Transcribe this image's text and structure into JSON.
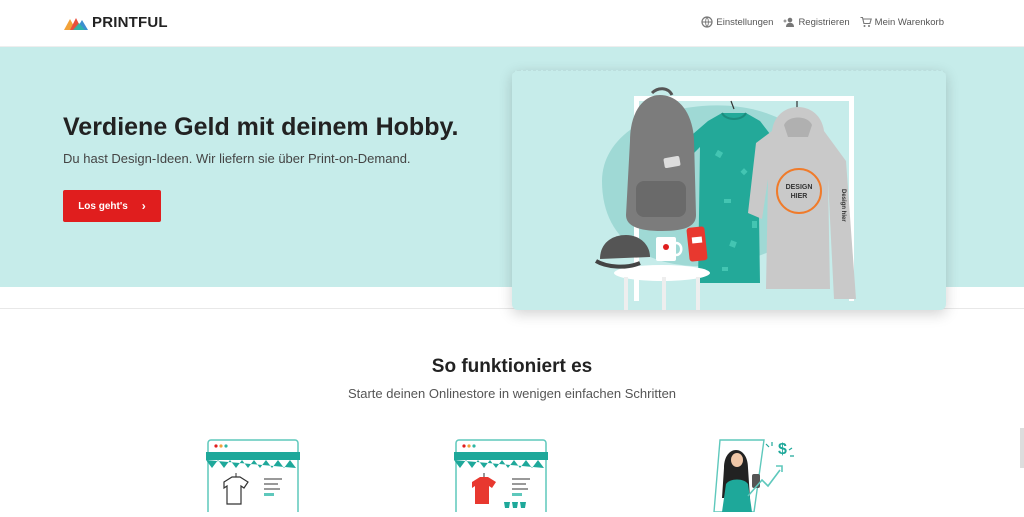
{
  "header": {
    "logo_text": "PRINTFUL",
    "nav": [
      {
        "label": "Einstellungen",
        "icon": "globe-icon"
      },
      {
        "label": "Registrieren",
        "icon": "add-user-icon"
      },
      {
        "label": "Mein Warenkorb",
        "icon": "cart-icon"
      }
    ]
  },
  "hero": {
    "title": "Verdiene Geld mit deinem Hobby.",
    "subtitle": "Du hast Design-Ideen. Wir liefern sie über Print-on-Demand.",
    "cta_label": "Los geht's",
    "image_text": {
      "hoodie_line1": "DESIGN",
      "hoodie_line2": "HIER",
      "sleeve": "Design hier"
    }
  },
  "how": {
    "title": "So funktioniert es",
    "subtitle": "Starte deinen Onlinestore in wenigen einfachen Schritten"
  },
  "colors": {
    "accent": "#e01e1e",
    "hero_bg": "#c6ecea",
    "teal": "#1ea89a"
  }
}
